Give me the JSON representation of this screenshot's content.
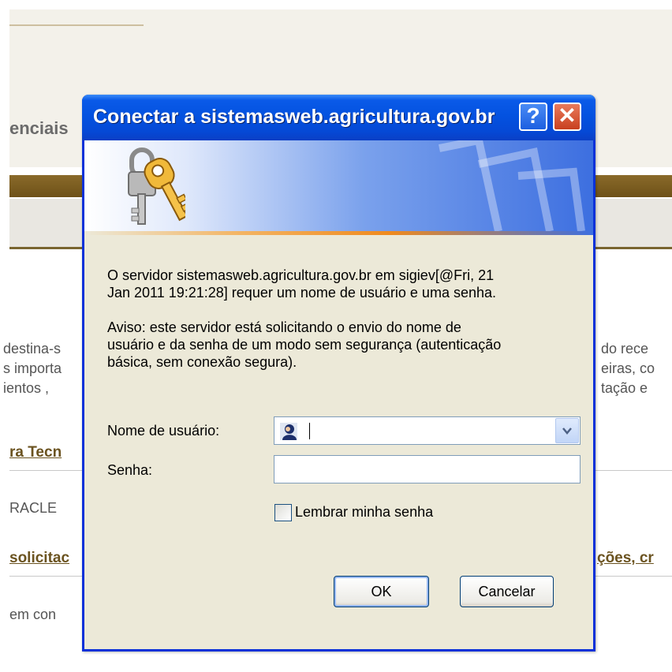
{
  "background_page": {
    "section_title": "enciais",
    "body_lines": [
      {
        "left": "destina-s",
        "right": "do rece"
      },
      {
        "left": "s importa",
        "right": "eiras, co"
      },
      {
        "left": "ientos ,",
        "right": "tação e"
      }
    ],
    "link_1": "ra Tecn",
    "text_oracle": "RACLE",
    "link_2_left": "solicitac",
    "link_2_right": "ções, cr",
    "text_em_con": "em con"
  },
  "dialog": {
    "title": "Conectar a sistemasweb.agricultura.gov.br",
    "help_label": "?",
    "close_label": "✕",
    "message_1_line_1": "O servidor sistemasweb.agricultura.gov.br em sigiev[@Fri, 21",
    "message_1_line_2": "Jan 2011 19:21:28] requer um nome de usuário e uma senha.",
    "message_2_line_1": "Aviso: este servidor está solicitando o envio do nome de",
    "message_2_line_2": "usuário e da senha de um modo sem segurança (autenticação",
    "message_2_line_3": "básica, sem conexão segura).",
    "username_label": "Nome de usuário:",
    "username_value": "",
    "password_label": "Senha:",
    "password_value": "",
    "remember_label": "Lembrar minha senha",
    "remember_checked": false,
    "ok_label": "OK",
    "cancel_label": "Cancelar"
  },
  "icons": {
    "title_help": "help-icon",
    "title_close": "close-icon",
    "banner": "keys-icon",
    "username": "user-icon",
    "dropdown": "chevron-down-icon"
  },
  "colors": {
    "titlebar": "#0452e0",
    "dialog_face": "#ece9d8",
    "brown_bar": "#7a5a20",
    "close_red": "#c8401f"
  }
}
